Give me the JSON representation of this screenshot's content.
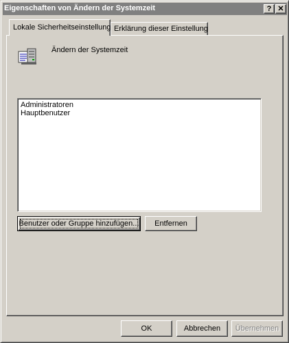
{
  "window": {
    "title": "Eigenschaften von Ändern der Systemzeit",
    "help_label": "?",
    "close_label": "✕"
  },
  "tabs": [
    {
      "label": "Lokale Sicherheitseinstellung",
      "active": true
    },
    {
      "label": "Erklärung dieser Einstellung",
      "active": false
    }
  ],
  "policy": {
    "icon": "security-policy-icon",
    "name": "Ändern der Systemzeit"
  },
  "members": {
    "items": [
      "Administratoren",
      "Hauptbenutzer"
    ]
  },
  "buttons": {
    "add_label": "Benutzer oder Gruppe hinzufügen...",
    "remove_label": "Entfernen",
    "ok_label": "OK",
    "cancel_label": "Abbrechen",
    "apply_label": "Übernehmen"
  },
  "colors": {
    "titlebar_inactive": "#808080",
    "face": "#d4d0c8",
    "disabled_text": "#808080"
  }
}
